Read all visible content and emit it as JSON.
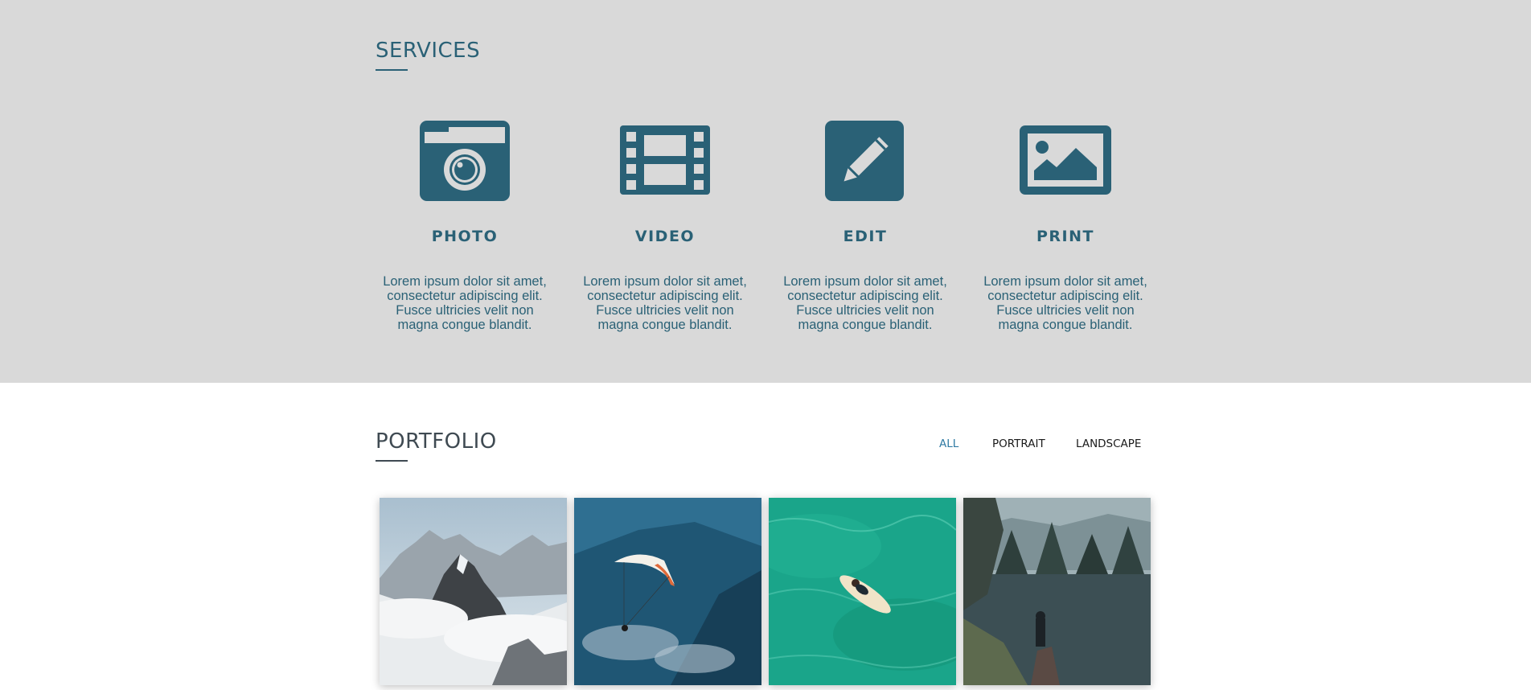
{
  "services": {
    "title": "SERVICES",
    "items": [
      {
        "name": "PHOTO",
        "icon": "camera-icon",
        "description": "Lorem ipsum dolor sit amet, consectetur adipiscing elit. Fusce ultricies velit non magna congue blandit."
      },
      {
        "name": "VIDEO",
        "icon": "film-icon",
        "description": "Lorem ipsum dolor sit amet, consectetur adipiscing elit. Fusce ultricies velit non magna congue blandit."
      },
      {
        "name": "EDIT",
        "icon": "pencil-icon",
        "description": "Lorem ipsum dolor sit amet, consectetur adipiscing elit. Fusce ultricies velit non magna congue blandit."
      },
      {
        "name": "PRINT",
        "icon": "image-icon",
        "description": "Lorem ipsum dolor sit amet, consectetur adipiscing elit. Fusce ultricies velit non magna congue blandit."
      }
    ]
  },
  "portfolio": {
    "title": "PORTFOLIO",
    "filters": [
      {
        "label": "ALL",
        "active": true
      },
      {
        "label": "PORTRAIT",
        "active": false
      },
      {
        "label": "LANDSCAPE",
        "active": false
      }
    ],
    "images": [
      {
        "subject": "snowy-mountain-photo"
      },
      {
        "subject": "paraglider-photo"
      },
      {
        "subject": "surfer-photo"
      },
      {
        "subject": "lake-forest-photo"
      }
    ]
  },
  "colors": {
    "accent": "#2a6176",
    "services_background": "#d9d9d9",
    "active_filter": "#2f7aa3"
  }
}
